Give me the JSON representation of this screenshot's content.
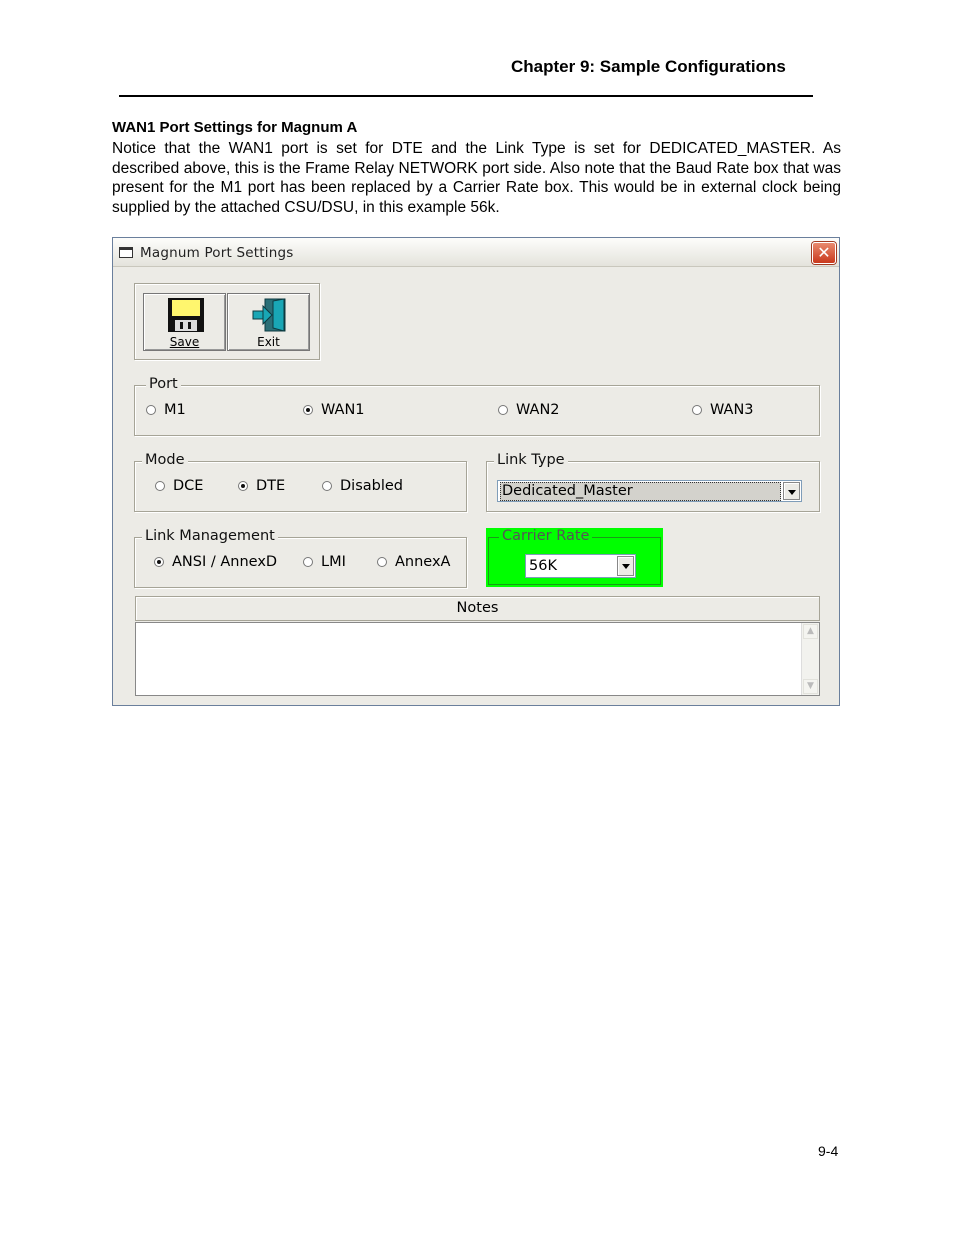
{
  "header": {
    "chapter": "Chapter 9: Sample Configurations"
  },
  "section": {
    "heading": "WAN1 Port Settings for Magnum A",
    "paragraph": "Notice that the WAN1 port is set for DTE and the Link Type is set for DEDICATED_MASTER. As described above, this is the Frame Relay NETWORK port side.  Also note that the Baud Rate box that was present for the M1 port has been replaced by a Carrier Rate box.  This would be in external clock being supplied by the attached CSU/DSU, in this example 56k."
  },
  "window": {
    "title": "Magnum Port Settings",
    "toolbar": {
      "save_label": "Save",
      "exit_label": "Exit"
    },
    "port": {
      "legend": "Port",
      "options": [
        {
          "label": "M1",
          "selected": false
        },
        {
          "label": "WAN1",
          "selected": true
        },
        {
          "label": "WAN2",
          "selected": false
        },
        {
          "label": "WAN3",
          "selected": false
        }
      ]
    },
    "mode": {
      "legend": "Mode",
      "options": [
        {
          "label": "DCE",
          "selected": false
        },
        {
          "label": "DTE",
          "selected": true
        },
        {
          "label": "Disabled",
          "selected": false
        }
      ]
    },
    "link_type": {
      "legend": "Link Type",
      "value": "Dedicated_Master"
    },
    "link_management": {
      "legend": "Link Management",
      "options": [
        {
          "label": "ANSI / AnnexD",
          "selected": true
        },
        {
          "label": "LMI",
          "selected": false
        },
        {
          "label": "AnnexA",
          "selected": false
        }
      ]
    },
    "carrier_rate": {
      "legend": "Carrier Rate",
      "value": "56K",
      "highlight_color": "#00ff00"
    },
    "notes": {
      "header": "Notes",
      "value": ""
    }
  },
  "footer": {
    "page_number": "9-4"
  }
}
